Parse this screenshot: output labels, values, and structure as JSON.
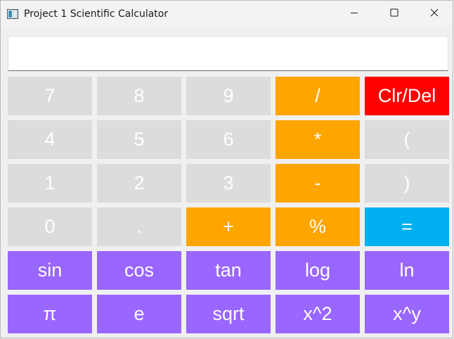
{
  "window": {
    "title": "Project 1 Scientific Calculator",
    "icon": "calculator-app-icon",
    "controls": {
      "minimize_icon": "minimize-icon",
      "maximize_icon": "maximize-icon",
      "close_icon": "close-icon"
    }
  },
  "display": {
    "value": ""
  },
  "colors": {
    "number_key": "#dcdcdc",
    "operator_key": "#ffa500",
    "clear_key": "#ff0000",
    "equals_key": "#00b0f0",
    "function_key": "#9966ff",
    "key_text": "#ffffff"
  },
  "keys": [
    {
      "label": "7",
      "kind": "grey"
    },
    {
      "label": "8",
      "kind": "grey"
    },
    {
      "label": "9",
      "kind": "grey"
    },
    {
      "label": "/",
      "kind": "orange"
    },
    {
      "label": "Clr/Del",
      "kind": "red"
    },
    {
      "label": "4",
      "kind": "grey"
    },
    {
      "label": "5",
      "kind": "grey"
    },
    {
      "label": "6",
      "kind": "grey"
    },
    {
      "label": "*",
      "kind": "orange"
    },
    {
      "label": "(",
      "kind": "grey"
    },
    {
      "label": "1",
      "kind": "grey"
    },
    {
      "label": "2",
      "kind": "grey"
    },
    {
      "label": "3",
      "kind": "grey"
    },
    {
      "label": "-",
      "kind": "orange"
    },
    {
      "label": ")",
      "kind": "grey"
    },
    {
      "label": "0",
      "kind": "grey"
    },
    {
      "label": ".",
      "kind": "grey"
    },
    {
      "label": "+",
      "kind": "orange"
    },
    {
      "label": "%",
      "kind": "orange"
    },
    {
      "label": "=",
      "kind": "blue"
    },
    {
      "label": "sin",
      "kind": "purple"
    },
    {
      "label": "cos",
      "kind": "purple"
    },
    {
      "label": "tan",
      "kind": "purple"
    },
    {
      "label": "log",
      "kind": "purple"
    },
    {
      "label": "ln",
      "kind": "purple"
    },
    {
      "label": "π",
      "kind": "purple"
    },
    {
      "label": "e",
      "kind": "purple"
    },
    {
      "label": "sqrt",
      "kind": "purple"
    },
    {
      "label": "x^2",
      "kind": "purple"
    },
    {
      "label": "x^y",
      "kind": "purple"
    }
  ]
}
